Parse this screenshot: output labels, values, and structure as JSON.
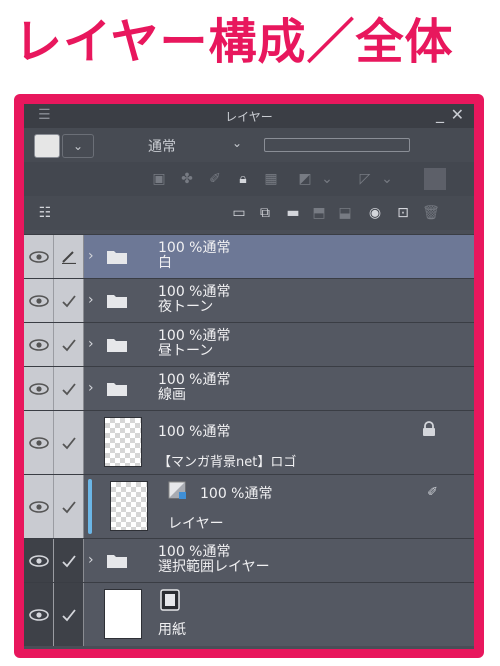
{
  "heading": "レイヤー構成／全体",
  "panel": {
    "title": "レイヤー",
    "blend_mode": "通常"
  },
  "layers": [
    {
      "mode": "100 %通常",
      "name": "白",
      "type": "folder",
      "selected": true
    },
    {
      "mode": "100 %通常",
      "name": "夜トーン",
      "type": "folder"
    },
    {
      "mode": "100 %通常",
      "name": "昼トーン",
      "type": "folder"
    },
    {
      "mode": "100 %通常",
      "name": "線画",
      "type": "folder"
    },
    {
      "mode": "100 %通常",
      "name": "【マンガ背景net】ロゴ",
      "type": "raster",
      "locked": true
    },
    {
      "mode": "100 %通常",
      "name": "レイヤー",
      "type": "raster-clip"
    },
    {
      "mode": "100 %通常",
      "name": "選択範囲レイヤー",
      "type": "folder"
    },
    {
      "mode": "",
      "name": "用紙",
      "type": "paper"
    }
  ],
  "icons": {
    "menu": "menu-icon",
    "close": "close-icon",
    "minimize": "minimize-icon"
  },
  "colors": {
    "accent": "#e8175d",
    "panel": "#4a4e57",
    "selected": "#6d7896",
    "clip": "#6bb6e6"
  }
}
